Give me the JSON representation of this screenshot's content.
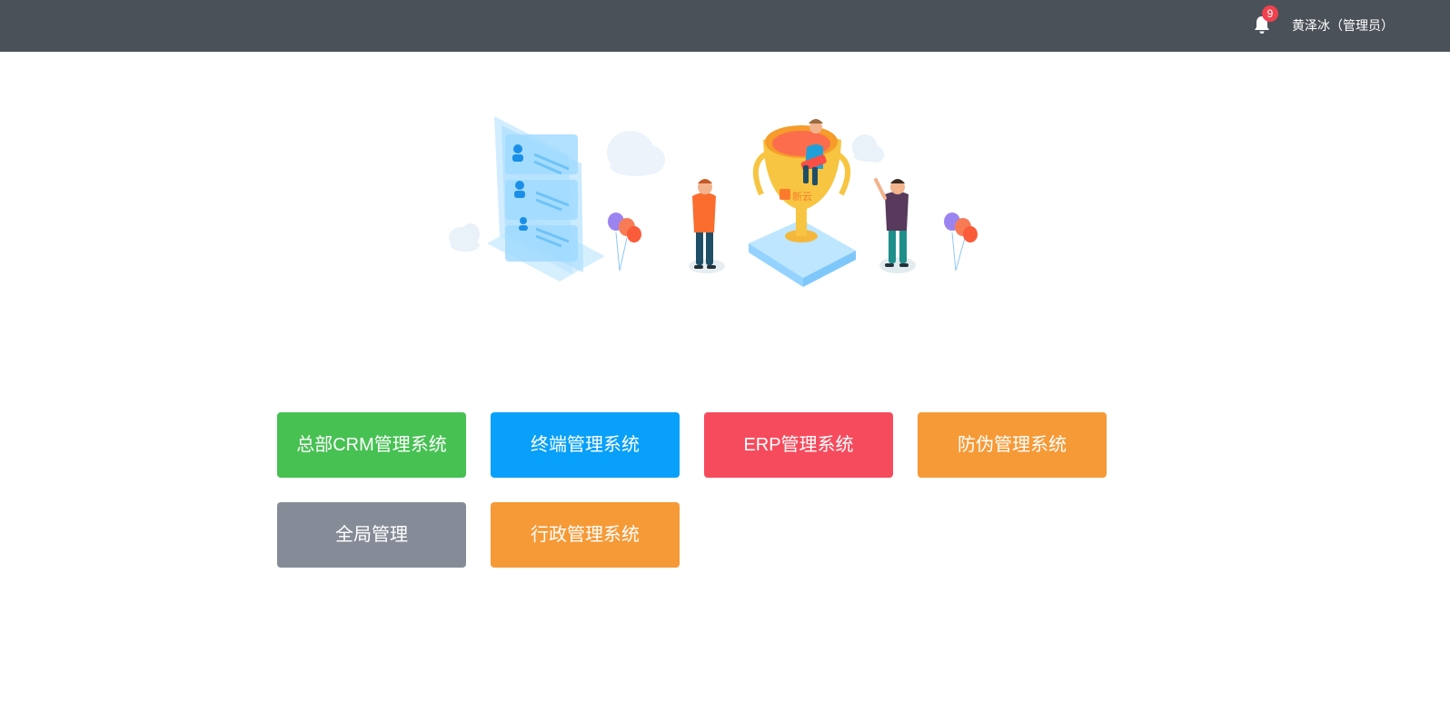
{
  "header": {
    "notification_count": "9",
    "user_name": "黄泽冰（管理员）",
    "icons": {
      "notification": "bell-icon"
    }
  },
  "hero": {
    "illustration": "trophy-and-team-illustration",
    "trophy_text": "新云"
  },
  "systems": [
    {
      "label": "总部CRM管理系统",
      "color": "#46c152"
    },
    {
      "label": "终端管理系统",
      "color": "#08a0fa"
    },
    {
      "label": "ERP管理系统",
      "color": "#f64b5d"
    },
    {
      "label": "防伪管理系统",
      "color": "#f69a37"
    },
    {
      "label": "全局管理",
      "color": "#868c97"
    },
    {
      "label": "行政管理系统",
      "color": "#f69a37"
    }
  ],
  "colors": {
    "topbar": "#4b5158",
    "badge": "#f0414f"
  }
}
